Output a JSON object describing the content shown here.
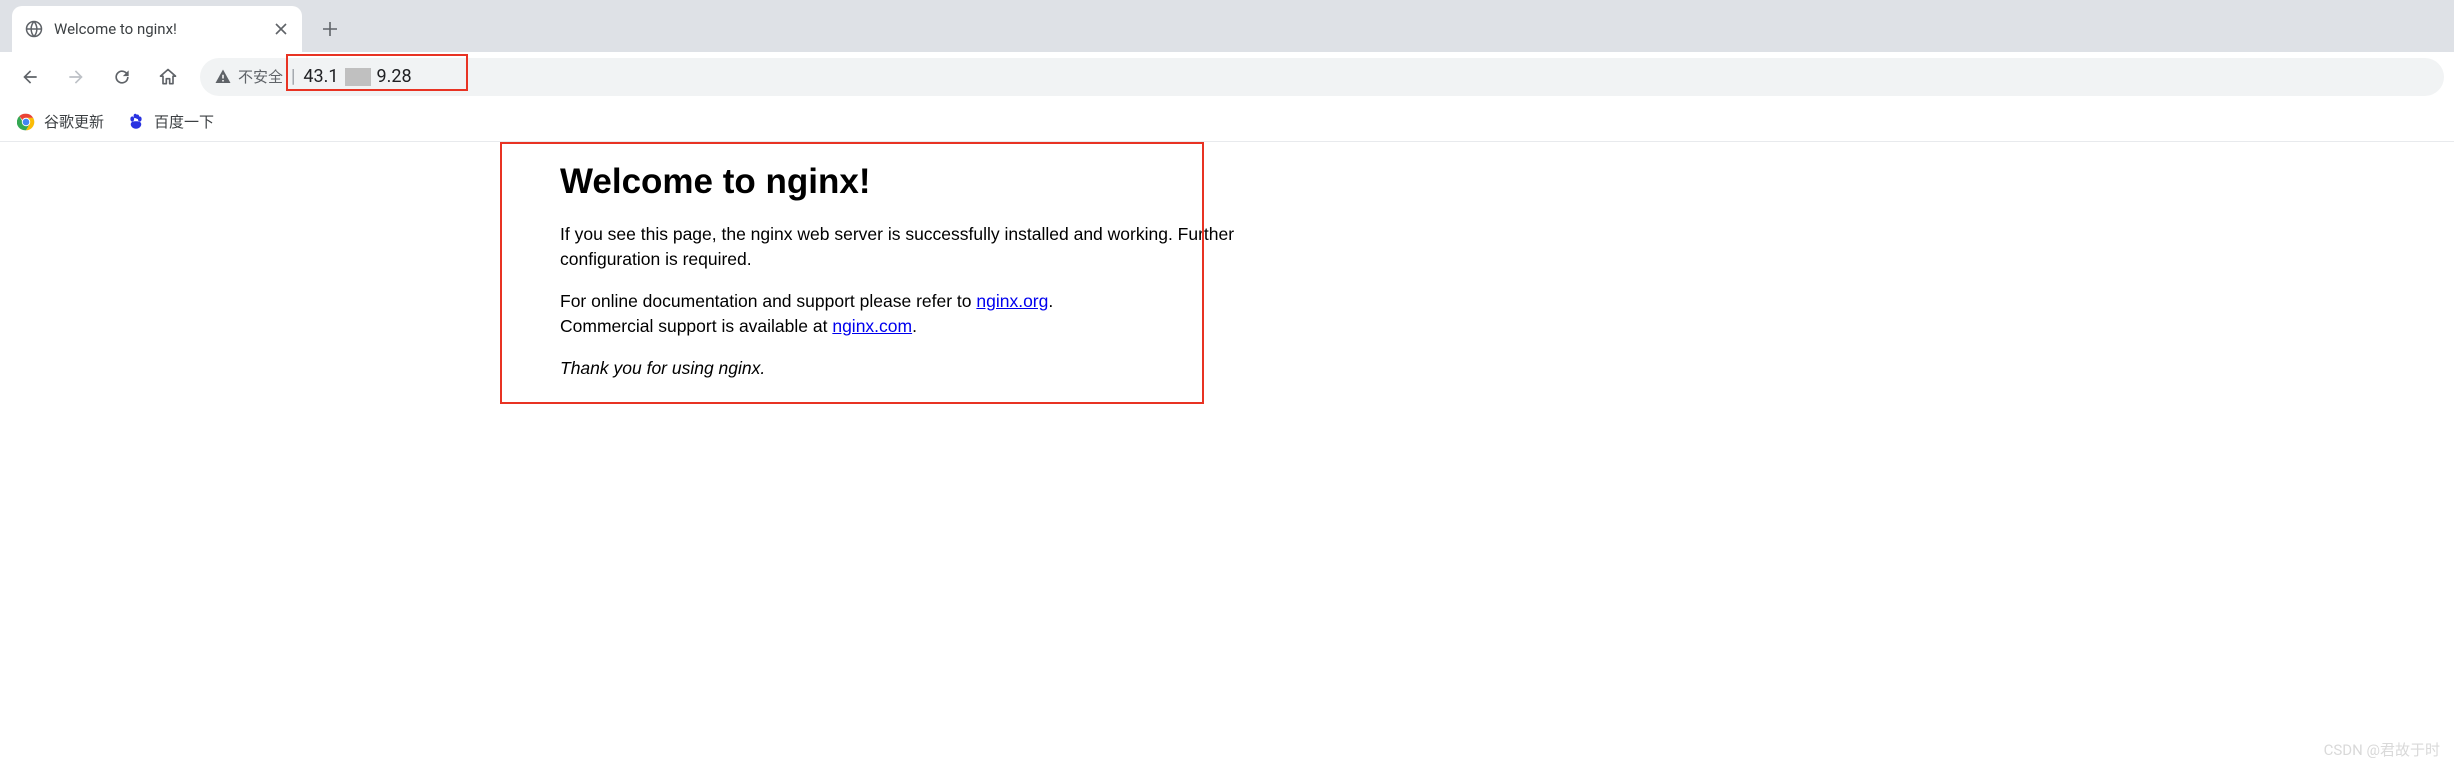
{
  "tab": {
    "title": "Welcome to nginx!"
  },
  "addressbar": {
    "warning_label": "不安全",
    "url_prefix": "43.1",
    "url_suffix": "9.28"
  },
  "bookmarks": [
    {
      "label": "谷歌更新",
      "icon": "chrome"
    },
    {
      "label": "百度一下",
      "icon": "baidu"
    }
  ],
  "page": {
    "heading": "Welcome to nginx!",
    "paragraph1": "If you see this page, the nginx web server is successfully installed and working. Further configuration is required.",
    "paragraph2_prefix": "For online documentation and support please refer to ",
    "link1_text": "nginx.org",
    "paragraph2_mid": ".",
    "paragraph2_line2_prefix": "Commercial support is available at ",
    "link2_text": "nginx.com",
    "paragraph2_suffix": ".",
    "thankyou": "Thank you for using nginx."
  },
  "watermark": "CSDN @君故于时"
}
